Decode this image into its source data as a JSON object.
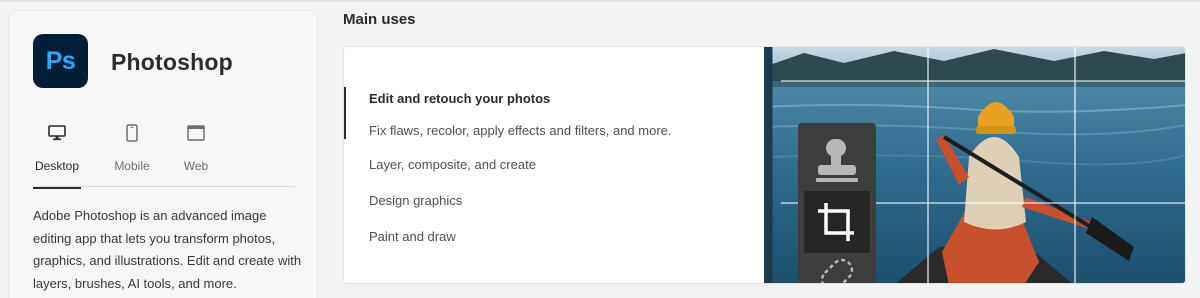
{
  "app": {
    "logo_text": "Ps",
    "name": "Photoshop",
    "platforms": [
      {
        "label": "Desktop",
        "icon": "desktop-icon",
        "active": true
      },
      {
        "label": "Mobile",
        "icon": "mobile-icon",
        "active": false
      },
      {
        "label": "Web",
        "icon": "web-icon",
        "active": false
      }
    ],
    "description": "Adobe Photoshop is an advanced image editing app that lets you transform photos, graphics, and illustrations. Edit and create with layers, brushes, AI tools, and more."
  },
  "main_uses": {
    "title": "Main uses",
    "items": [
      {
        "label": "Edit and retouch your photos",
        "active": true,
        "description": "Fix flaws, recolor, apply effects and filters, and more."
      },
      {
        "label": "Layer, composite, and create",
        "active": false
      },
      {
        "label": "Design graphics",
        "active": false
      },
      {
        "label": "Paint and draw",
        "active": false
      }
    ],
    "tool_icons": [
      "stamp-icon",
      "crop-icon",
      "healing-bandage-icon"
    ]
  },
  "colors": {
    "logo_bg": "#001e36",
    "logo_text": "#31a8ff",
    "tool_panel": "#3d3d3d"
  }
}
